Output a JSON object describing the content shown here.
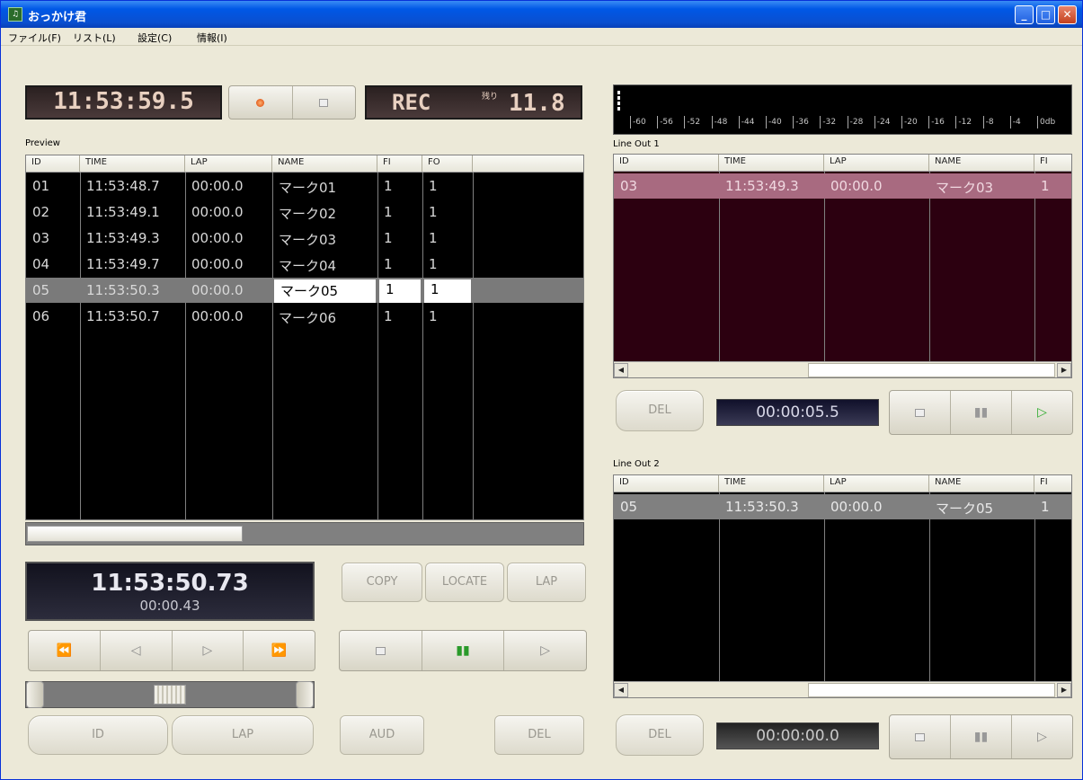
{
  "window": {
    "title": "おっかけ君",
    "min": "_",
    "max": "□",
    "close": "✕"
  },
  "menu": [
    "ファイル(F)",
    "リスト(L)",
    "設定(C)",
    "情報(I)"
  ],
  "top": {
    "clock": "11:53:59.5",
    "rec_label": "REC",
    "remain_label": "残り",
    "remain_value": "11.8"
  },
  "preview": {
    "label": "Preview",
    "columns": [
      "ID",
      "TIME",
      "LAP",
      "NAME",
      "FI",
      "FO"
    ],
    "rows": [
      [
        "01",
        "11:53:48.7",
        "00:00.0",
        "マーク01",
        "1",
        "1"
      ],
      [
        "02",
        "11:53:49.1",
        "00:00.0",
        "マーク02",
        "1",
        "1"
      ],
      [
        "03",
        "11:53:49.3",
        "00:00.0",
        "マーク03",
        "1",
        "1"
      ],
      [
        "04",
        "11:53:49.7",
        "00:00.0",
        "マーク04",
        "1",
        "1"
      ],
      [
        "05",
        "11:53:50.3",
        "00:00.0",
        "マーク05",
        "1",
        "1"
      ],
      [
        "06",
        "11:53:50.7",
        "00:00.0",
        "マーク06",
        "1",
        "1"
      ]
    ],
    "selected_row": 4
  },
  "player": {
    "time": "11:53:50.73",
    "lap": "00:00.43"
  },
  "buttons": {
    "copy": "COPY",
    "locate": "LOCATE",
    "lap": "LAP",
    "id": "ID",
    "lap2": "LAP",
    "aud": "AUD",
    "del": "DEL"
  },
  "meter": {
    "ticks": [
      "-60",
      "-56",
      "-52",
      "-48",
      "-44",
      "-40",
      "-36",
      "-32",
      "-28",
      "-24",
      "-20",
      "-16",
      "-12",
      "-8",
      "-4",
      "0db"
    ]
  },
  "lineout1": {
    "label": "Line Out 1",
    "columns": [
      "ID",
      "TIME",
      "LAP",
      "NAME",
      "FI"
    ],
    "rows": [
      [
        "03",
        "11:53:49.3",
        "00:00.0",
        "マーク03",
        "1"
      ]
    ],
    "del": "DEL",
    "time": "00:00:05.5"
  },
  "lineout2": {
    "label": "Line Out 2",
    "columns": [
      "ID",
      "TIME",
      "LAP",
      "NAME",
      "FI"
    ],
    "rows": [
      [
        "05",
        "11:53:50.3",
        "00:00.0",
        "マーク05",
        "1"
      ]
    ],
    "del": "DEL",
    "time": "00:00:00.0"
  },
  "colors": {
    "accent_lcd": "#3a2d2d",
    "lineout1_bg": "#2c0010",
    "lineout1_row": "#a86a80",
    "selected_row": "#7a7a7a"
  }
}
